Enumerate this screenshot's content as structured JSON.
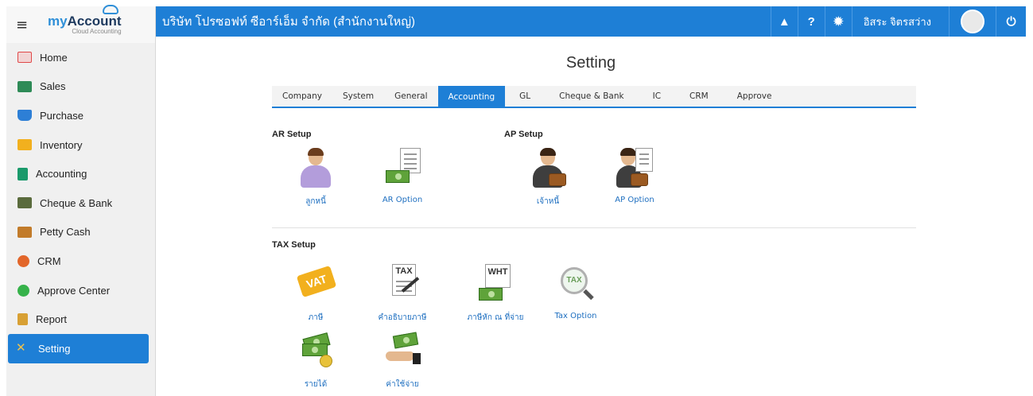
{
  "sidebar": {
    "logo": {
      "brand": "Account",
      "brand_prefix": "my",
      "tagline": "Cloud Accounting"
    },
    "items": [
      {
        "label": "Home",
        "icon": "home-icon",
        "color": "#e04848"
      },
      {
        "label": "Sales",
        "icon": "sales-icon",
        "color": "#2e8b57"
      },
      {
        "label": "Purchase",
        "icon": "cart-icon",
        "color": "#2d7fd6"
      },
      {
        "label": "Inventory",
        "icon": "box-icon",
        "color": "#f2b01e"
      },
      {
        "label": "Accounting",
        "icon": "ledger-icon",
        "color": "#1a9a6b"
      },
      {
        "label": "Cheque & Bank",
        "icon": "bank-icon",
        "color": "#5a6b3d"
      },
      {
        "label": "Petty Cash",
        "icon": "wallet-icon",
        "color": "#c27b2a"
      },
      {
        "label": "CRM",
        "icon": "crm-icon",
        "color": "#e2662a"
      },
      {
        "label": "Approve Center",
        "icon": "check-circle-icon",
        "color": "#36b24a"
      },
      {
        "label": "Report",
        "icon": "report-icon",
        "color": "#d8a034"
      },
      {
        "label": "Setting",
        "icon": "tools-icon",
        "color": "#f0c24a"
      }
    ]
  },
  "header": {
    "company": "บริษัท โปรซอฟท์ ซีอาร์เอ็ม จำกัด (สำนักงานใหญ่)",
    "bell_icon": "▲",
    "help_label": "?",
    "gear_icon": "✹",
    "user_name": "อิสระ จิตรสว่าง",
    "power_icon": "⏻"
  },
  "page": {
    "title": "Setting",
    "tabs": [
      "Company",
      "System",
      "General",
      "Accounting",
      "GL",
      "Cheque & Bank",
      "IC",
      "CRM",
      "Approve"
    ],
    "active_tab": "Accounting",
    "ar_setup": {
      "title": "AR Setup",
      "items": [
        "ลูกหนี้",
        "AR Option"
      ]
    },
    "ap_setup": {
      "title": "AP Setup",
      "items": [
        "เจ้าหนี้",
        "AP Option"
      ]
    },
    "tax_setup": {
      "title": "TAX Setup",
      "items": [
        "ภาษี",
        "คำอธิบายภาษี",
        "ภาษีหัก ณ ที่จ่าย",
        "Tax Option",
        "รายได้",
        "ค่าใช้จ่าย"
      ],
      "badges": {
        "vat": "VAT",
        "tax_doc": "TAX",
        "wht": "WHT",
        "tax_lens": "TAX"
      }
    }
  },
  "colors": {
    "accent": "#1e7fd6",
    "link": "#1e6fc0"
  }
}
